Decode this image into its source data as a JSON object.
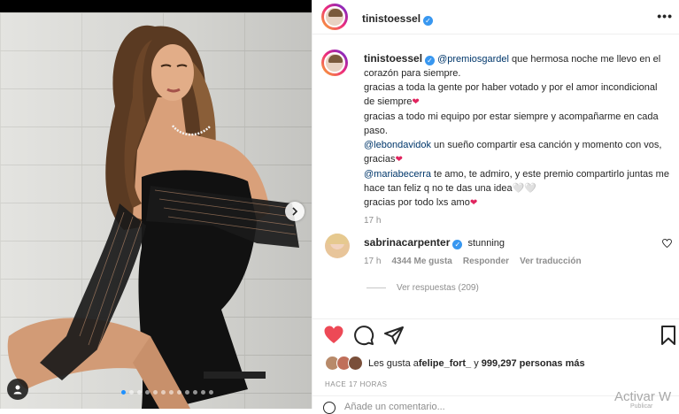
{
  "post": {
    "author": "tinistoessel",
    "carousel_total": 12,
    "carousel_active": 1
  },
  "caption": {
    "author": "tinistoessel",
    "mention1": "@premiosgardel",
    "line1": " que hermosa noche me llevo en el corazón para siempre.",
    "line2": "gracias a toda la gente por haber votado y por el amor incondicional de siempre",
    "line3": "gracias a todo mi equipo por estar siempre y acompañarme en cada paso.",
    "mention2": "@lebondavidok",
    "line4": " un sueño compartir esa canción y momento con vos, gracias",
    "mention3": "@mariabecerra",
    "line5": " te amo, te admiro, y este premio compartirlo juntas me hace tan feliz q no te das una idea",
    "line5_tail": "🤍🤍",
    "line6": "gracias por todo lxs amo",
    "heart": "❤",
    "time": "17 h"
  },
  "comment": {
    "author": "sabrinacarpenter",
    "text": "stunning",
    "time": "17 h",
    "likes": "4344 Me gusta",
    "reply": "Responder",
    "translate": "Ver traducción",
    "replies": "Ver respuestas (209)"
  },
  "likes": {
    "prefix": "Les gusta a ",
    "user": "felipe_fort_",
    "mid": " y ",
    "count": "999,297 personas más"
  },
  "time_ago": "HACE 17 HORAS",
  "add_comment_placeholder": "Añade un comentario...",
  "watermark": {
    "title": "Activar W",
    "sub": "Publicar"
  },
  "colors": {
    "like_red": "#ed4956",
    "verified_blue": "#3897f0",
    "mention": "#00376b"
  },
  "icons": [
    "more-icon",
    "verified-icon",
    "heart-icon",
    "comment-icon",
    "share-icon",
    "bookmark-icon",
    "next-arrow-icon",
    "tag-user-icon"
  ]
}
